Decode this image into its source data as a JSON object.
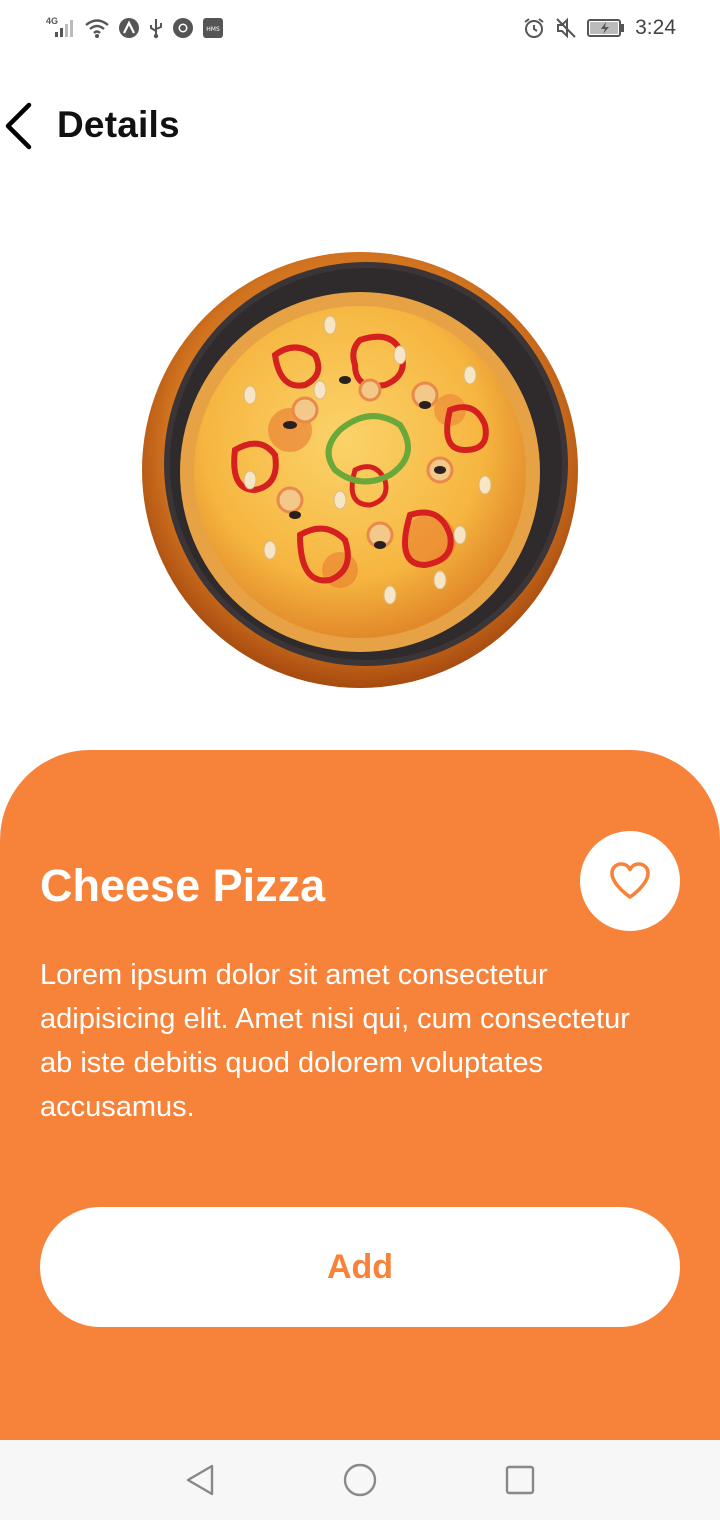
{
  "status_bar": {
    "network_type": "4G",
    "time": "3:24",
    "left_icons": [
      "signal-icon",
      "wifi-icon",
      "notification-app-icon",
      "usb-icon",
      "chrome-icon",
      "hms-icon"
    ],
    "hms_label": "HMS",
    "right_icons": [
      "alarm-icon",
      "mute-icon",
      "battery-charging-icon"
    ]
  },
  "header": {
    "title": "Details",
    "back_icon": "chevron-left-icon"
  },
  "product": {
    "image": "pizza-image",
    "name": "Cheese Pizza",
    "description": "Lorem ipsum dolor sit amet consectetur adipisicing elit. Amet nisi qui, cum consectetur ab iste debitis quod dolorem voluptates accusamus.",
    "favorite_icon": "heart-outline-icon",
    "add_label": "Add"
  },
  "nav_bar": {
    "buttons": [
      "back-triangle-icon",
      "home-circle-icon",
      "recents-square-icon"
    ]
  },
  "colors": {
    "accent": "#f7833a",
    "card_text": "#ffffff",
    "background": "#ffffff",
    "nav_background": "#f7f7f7"
  }
}
